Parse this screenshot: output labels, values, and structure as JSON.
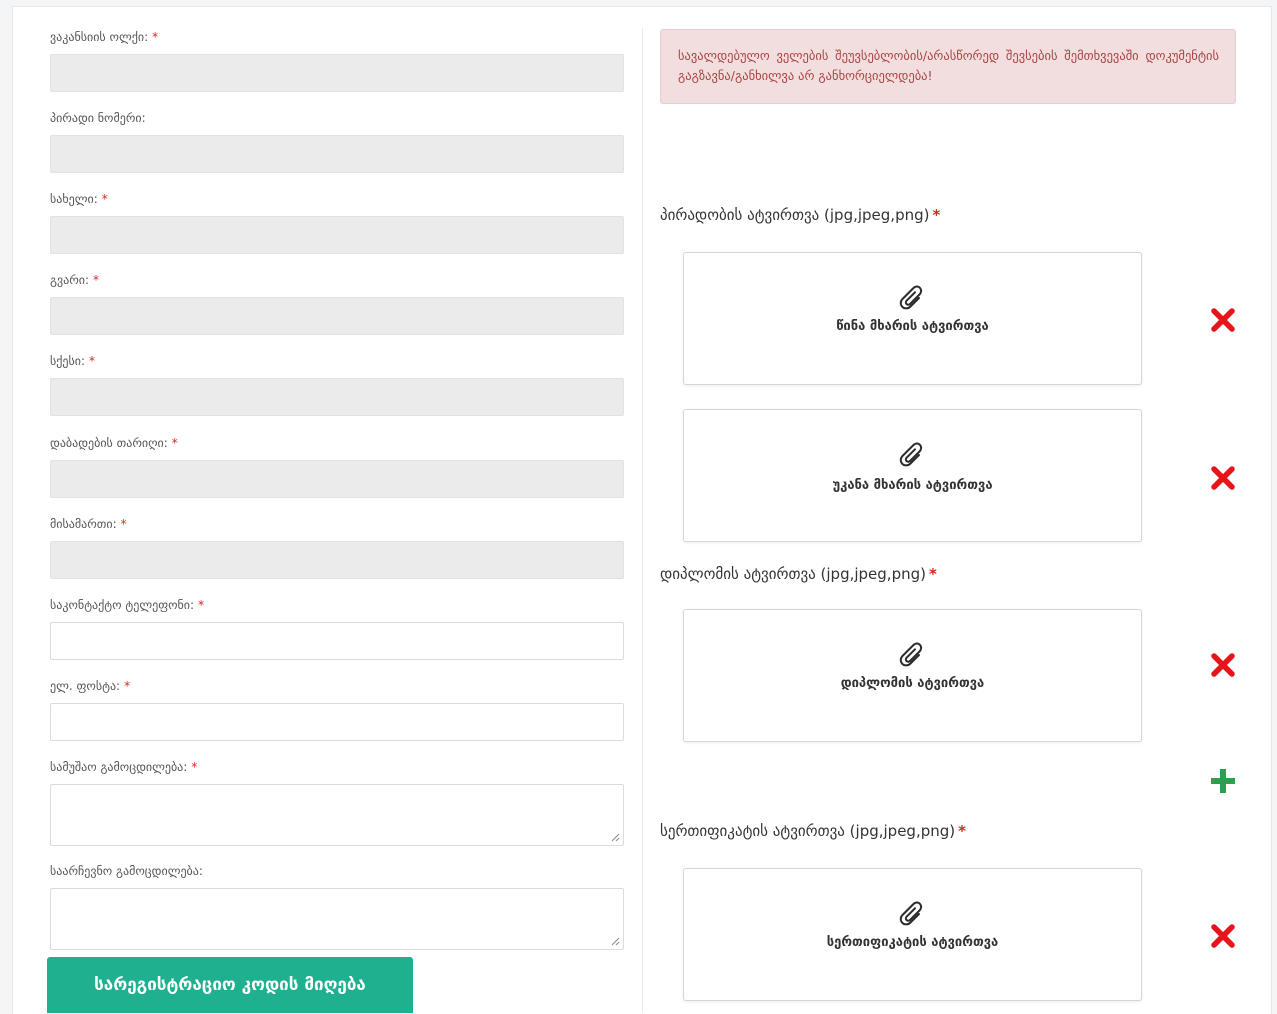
{
  "form": {
    "fields": [
      {
        "label": "ვაკანსიის ოლქი:",
        "required": true
      },
      {
        "label": "პირადი ნომერი:",
        "required": false
      },
      {
        "label": "სახელი:",
        "required": true
      },
      {
        "label": "გვარი:",
        "required": true
      },
      {
        "label": "სქესი:",
        "required": true
      },
      {
        "label": "დაბადების თარიღი:",
        "required": true
      },
      {
        "label": "მისამართი:",
        "required": true
      },
      {
        "label": "საკონტაქტო ტელეფონი:",
        "required": true
      },
      {
        "label": "ელ. ფოსტა:",
        "required": true
      },
      {
        "label": "სამუშაო გამოცდილება:",
        "required": true
      },
      {
        "label": "საარჩევნო გამოცდილება:",
        "required": false
      }
    ],
    "required_mark": "*",
    "submit_label": "სარეგისტრაციო კოდის მიღება"
  },
  "alert": {
    "text": "სავალდებულო ველების შეუვსებლობის/არასწორედ შევსების შემთხვევაში დოკუმენტის გაგზავნა/განხილვა არ განხორციელდება!"
  },
  "uploads": {
    "identity": {
      "title": "პირადობის ატვირთვა (jpg,jpeg,png)",
      "front_label": "წინა მხარის ატვირთვა",
      "back_label": "უკანა მხარის ატვირთვა"
    },
    "diploma": {
      "title": "დიპლომის ატვირთვა (jpg,jpeg,png)",
      "box_label": "დიპლომის ატვირთვა"
    },
    "certificate": {
      "title": "სერთიფიკატის ატვირთვა (jpg,jpeg,png)",
      "box_label": "სერთიფიკატის ატვირთვა"
    }
  },
  "colors": {
    "accent": "#1fb08f",
    "remove": "#e8141b",
    "add": "#2aa14f",
    "alert_bg": "#f2dede",
    "alert_text": "#a94442",
    "required": "#d9261c"
  },
  "icons": {
    "attach": "paperclip-icon",
    "remove": "close-icon",
    "add": "plus-icon"
  }
}
